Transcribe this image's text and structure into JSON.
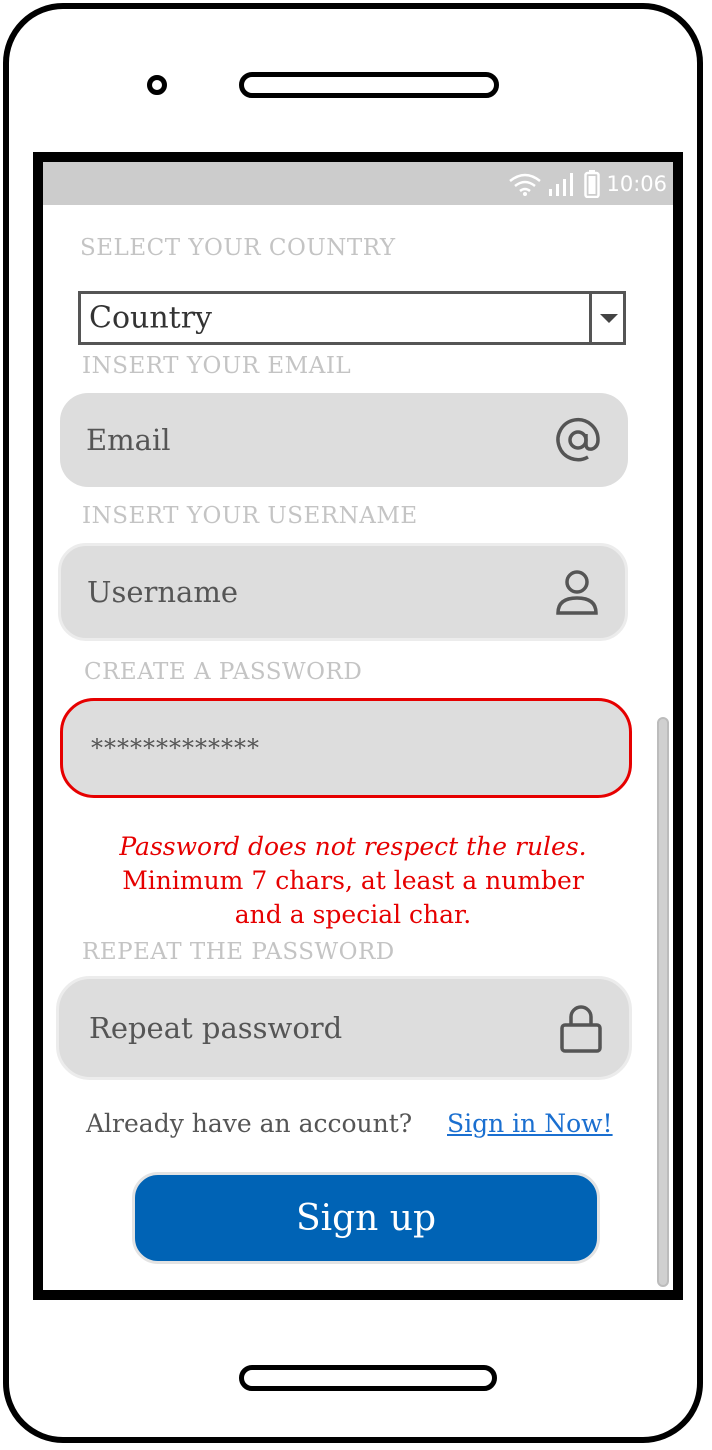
{
  "status": {
    "time": "10:06"
  },
  "country": {
    "label": "SELECT YOUR COUNTRY",
    "selected": "Country"
  },
  "email": {
    "label": "INSERT YOUR EMAIL",
    "placeholder": "Email",
    "icon": "at-icon"
  },
  "username": {
    "label": "INSERT YOUR USERNAME",
    "placeholder": "Username",
    "icon": "user-icon"
  },
  "password": {
    "label": "CREATE A PASSWORD",
    "value": "*************",
    "border_color": "#e60000"
  },
  "error": {
    "line1": "Password does not respect the rules.",
    "line2": "Minimum 7 chars, at least a number",
    "line3": "and a special char."
  },
  "repeat_password": {
    "label": "REPEAT THE PASSWORD",
    "placeholder": "Repeat password",
    "icon": "lock-icon"
  },
  "footer": {
    "question": "Already have an account?",
    "link": "Sign in Now!"
  },
  "signup": {
    "label": "Sign up",
    "color": "#0063b5"
  }
}
